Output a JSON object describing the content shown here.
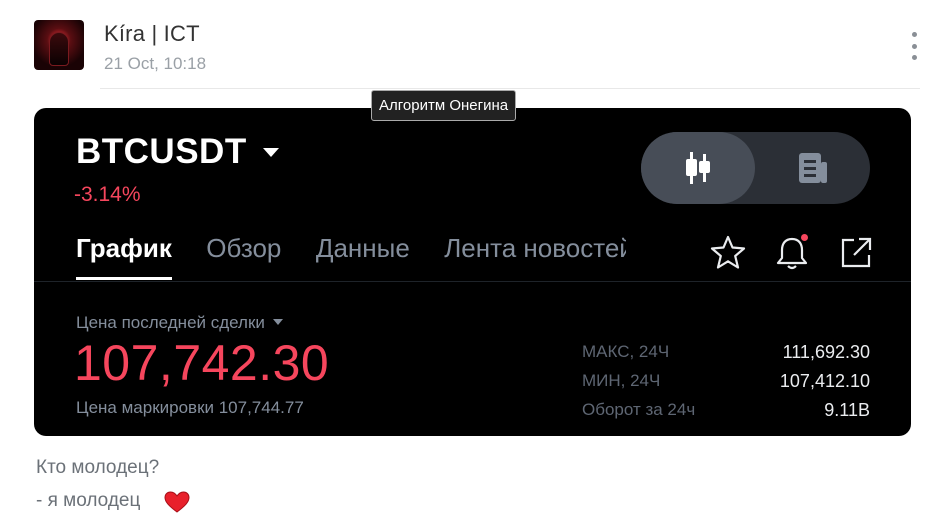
{
  "post": {
    "author": "Kíra | ICT",
    "date": "21 Oct, 10:18",
    "tooltip": "Алгоритм Онегина",
    "caption_line1": "Кто молодец?",
    "caption_line2": "- я молодец"
  },
  "ticker": {
    "symbol": "BTCUSDT",
    "change": "-3.14%",
    "tabs": [
      "График",
      "Обзор",
      "Данные",
      "Лента новостей"
    ],
    "active_tab": 0,
    "last_price_label": "Цена последней сделки",
    "last_price": "107,742.30",
    "mark_price": "Цена маркировки 107,744.77",
    "stats": [
      {
        "label": "МАКС, 24Ч",
        "value": "111,692.30"
      },
      {
        "label": "МИН, 24Ч",
        "value": "107,412.10"
      },
      {
        "label": "Оборот за 24ч",
        "value": "9.11B"
      }
    ]
  },
  "colors": {
    "negative": "#f6465d",
    "card_bg": "#000000",
    "muted": "#848e9c"
  },
  "icons": [
    "candlestick-icon",
    "news-icon",
    "star-icon",
    "bell-icon",
    "share-icon",
    "heart-icon",
    "more-vertical-icon"
  ]
}
